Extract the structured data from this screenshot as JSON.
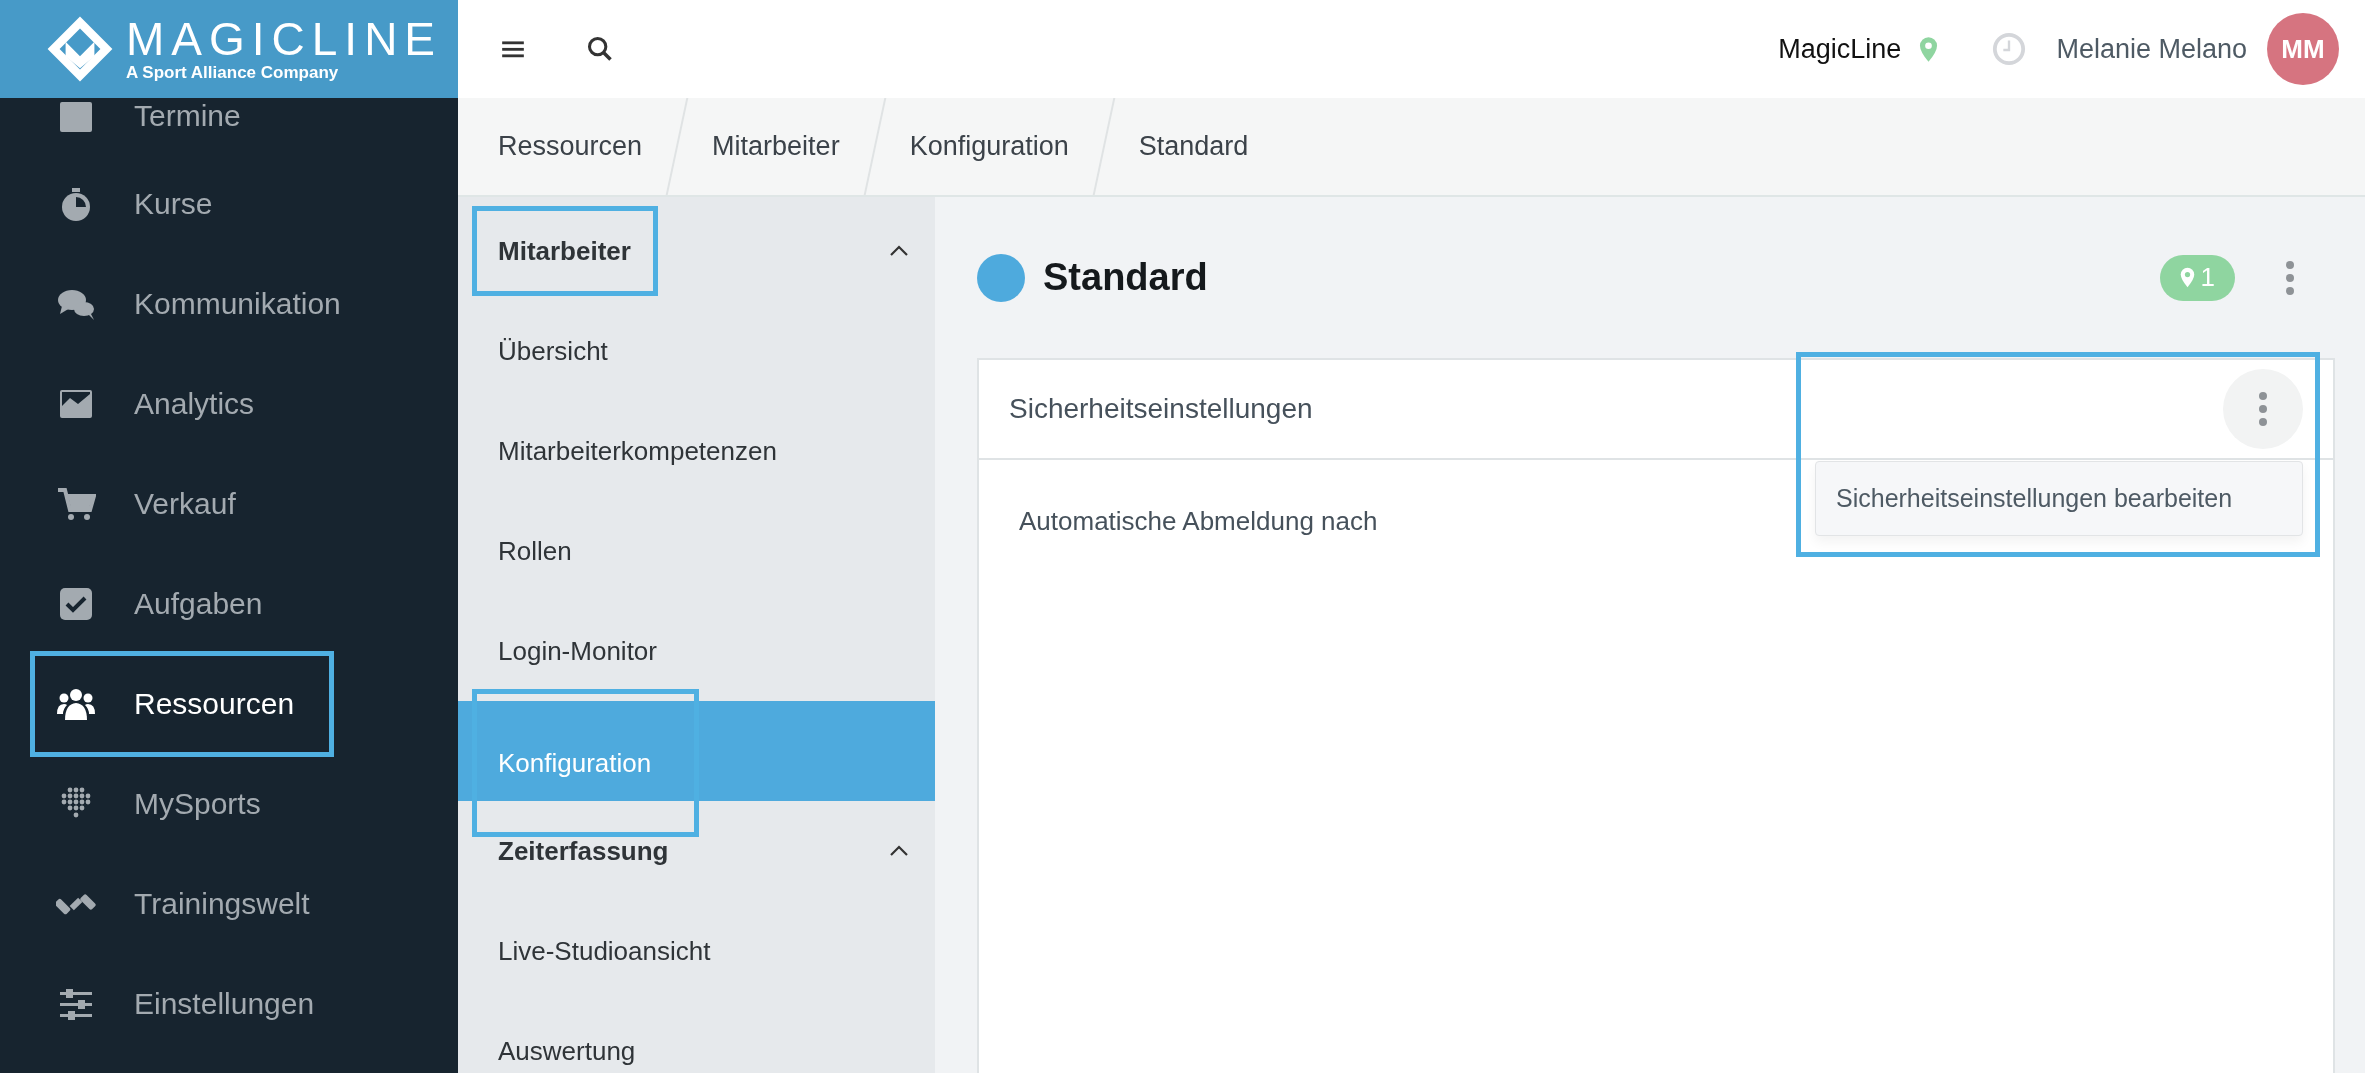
{
  "logo": {
    "name": "MAGICLINE",
    "tagline": "A Sport Alliance Company"
  },
  "sidebar": {
    "items": [
      {
        "label": "Termine",
        "kind": "calendar",
        "selected": false,
        "highlighted": false
      },
      {
        "label": "Kurse",
        "kind": "stopwatch",
        "selected": false,
        "highlighted": false
      },
      {
        "label": "Kommunikation",
        "kind": "chat",
        "selected": false,
        "highlighted": false
      },
      {
        "label": "Analytics",
        "kind": "chart",
        "selected": false,
        "highlighted": false
      },
      {
        "label": "Verkauf",
        "kind": "cart",
        "selected": false,
        "highlighted": false
      },
      {
        "label": "Aufgaben",
        "kind": "task",
        "selected": false,
        "highlighted": false
      },
      {
        "label": "Ressourcen",
        "kind": "people",
        "selected": true,
        "highlighted": true
      },
      {
        "label": "MySports",
        "kind": "dots",
        "selected": false,
        "highlighted": false
      },
      {
        "label": "Trainingswelt",
        "kind": "dumbbell",
        "selected": false,
        "highlighted": false
      },
      {
        "label": "Einstellungen",
        "kind": "sliders",
        "selected": false,
        "highlighted": false
      }
    ]
  },
  "topbar": {
    "studio": "MagicLine",
    "user": "Melanie Melano",
    "initials": "MM"
  },
  "breadcrumb": [
    "Ressourcen",
    "Mitarbeiter",
    "Konfiguration",
    "Standard"
  ],
  "subnav": {
    "items": [
      {
        "label": "Mitarbeiter",
        "kind": "header",
        "expanded": true,
        "selected": false,
        "highlighted": true
      },
      {
        "label": "Übersicht",
        "kind": "link",
        "selected": false,
        "highlighted": false
      },
      {
        "label": "Mitarbeiterkompetenzen",
        "kind": "link",
        "selected": false,
        "highlighted": false
      },
      {
        "label": "Rollen",
        "kind": "link",
        "selected": false,
        "highlighted": false
      },
      {
        "label": "Login-Monitor",
        "kind": "link",
        "selected": false,
        "highlighted": false
      },
      {
        "label": "Konfiguration",
        "kind": "link",
        "selected": true,
        "highlighted": true
      },
      {
        "label": "Zeiterfassung",
        "kind": "header",
        "expanded": true,
        "selected": false,
        "highlighted": false
      },
      {
        "label": "Live-Studioansicht",
        "kind": "link",
        "selected": false,
        "highlighted": false
      },
      {
        "label": "Auswertung",
        "kind": "link",
        "selected": false,
        "highlighted": false
      }
    ]
  },
  "page": {
    "title": "Standard",
    "color": "#4eaadd",
    "location_count": "1"
  },
  "card": {
    "title": "Sicherheitseinstellungen",
    "body": "Automatische Abmeldung nach",
    "menu": {
      "highlighted": true,
      "items": [
        "Sicherheitseinstellungen bearbeiten"
      ]
    }
  }
}
